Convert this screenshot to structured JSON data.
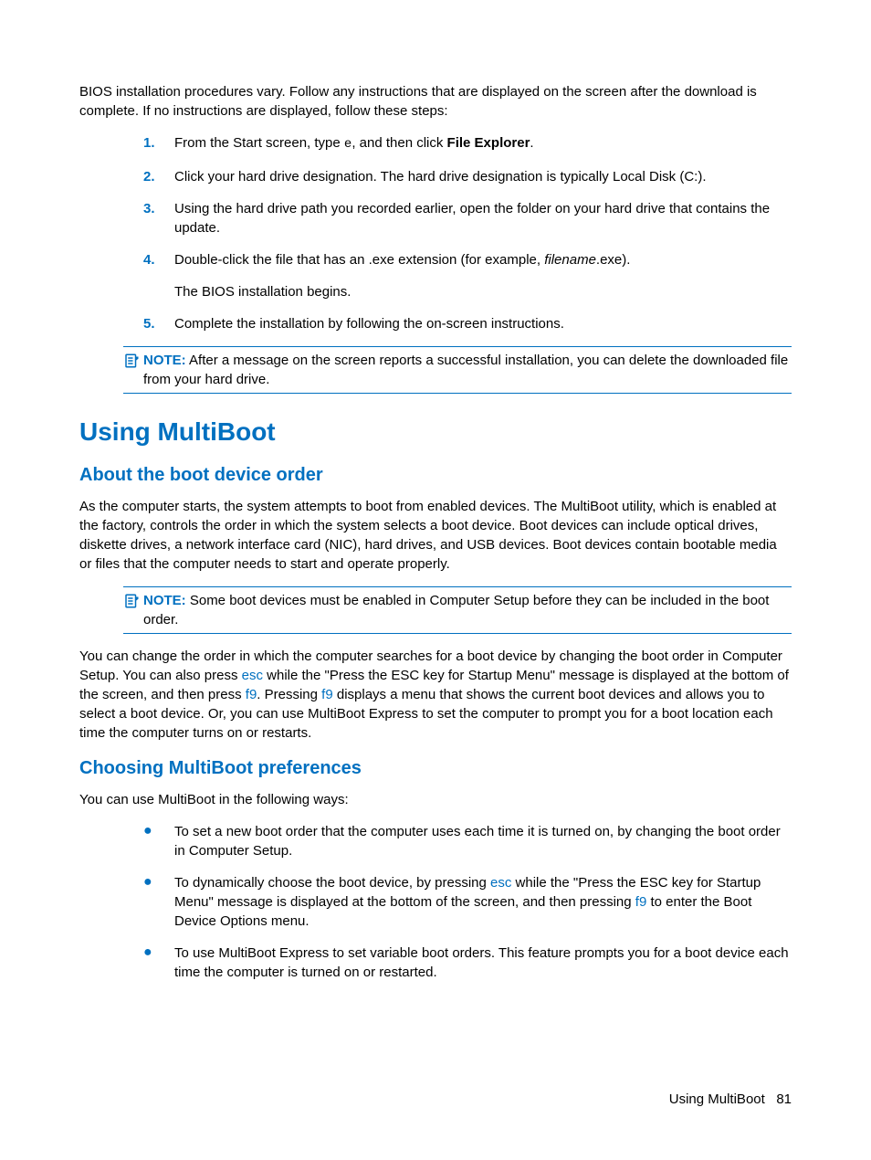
{
  "intro": "BIOS installation procedures vary. Follow any instructions that are displayed on the screen after the download is complete. If no instructions are displayed, follow these steps:",
  "steps": {
    "s1_a": "From the Start screen, type ",
    "s1_e": "e",
    "s1_b": ", and then click ",
    "s1_bold": "File Explorer",
    "s1_c": ".",
    "s2": "Click your hard drive designation. The hard drive designation is typically Local Disk (C:).",
    "s3": "Using the hard drive path you recorded earlier, open the folder on your hard drive that contains the update.",
    "s4_a": "Double-click the file that has an .exe extension (for example, ",
    "s4_i": "filename",
    "s4_b": ".exe).",
    "s4_sub": "The BIOS installation begins.",
    "s5": "Complete the installation by following the on-screen instructions."
  },
  "nums": {
    "n1": "1.",
    "n2": "2.",
    "n3": "3.",
    "n4": "4.",
    "n5": "5."
  },
  "note1_label": "NOTE:",
  "note1_text": "After a message on the screen reports a successful installation, you can delete the downloaded file from your hard drive.",
  "h1": "Using MultiBoot",
  "h2a": "About the boot device order",
  "para2": "As the computer starts, the system attempts to boot from enabled devices. The MultiBoot utility, which is enabled at the factory, controls the order in which the system selects a boot device. Boot devices can include optical drives, diskette drives, a network interface card (NIC), hard drives, and USB devices. Boot devices contain bootable media or files that the computer needs to start and operate properly.",
  "note2_label": "NOTE:",
  "note2_text": "Some boot devices must be enabled in Computer Setup before they can be included in the boot order.",
  "para3_a": "You can change the order in which the computer searches for a boot device by changing the boot order in Computer Setup. You can also press ",
  "para3_esc": "esc",
  "para3_b": " while the \"Press the ESC key for Startup Menu\" message is displayed at the bottom of the screen, and then press ",
  "para3_f9a": "f9",
  "para3_c": ". Pressing ",
  "para3_f9b": "f9",
  "para3_d": " displays a menu that shows the current boot devices and allows you to select a boot device. Or, you can use MultiBoot Express to set the computer to prompt you for a boot location each time the computer turns on or restarts.",
  "h2b": "Choosing MultiBoot preferences",
  "para4": "You can use MultiBoot in the following ways:",
  "bullets": {
    "b1": "To set a new boot order that the computer uses each time it is turned on, by changing the boot order in Computer Setup.",
    "b2_a": "To dynamically choose the boot device, by pressing ",
    "b2_esc": "esc",
    "b2_b": " while the \"Press the ESC key for Startup Menu\" message is displayed at the bottom of the screen, and then pressing ",
    "b2_f9": "f9",
    "b2_c": " to enter the Boot Device Options menu.",
    "b3": "To use MultiBoot Express to set variable boot orders. This feature prompts you for a boot device each time the computer is turned on or restarted."
  },
  "bullet_char": "●",
  "footer_text": "Using MultiBoot",
  "footer_page": "81"
}
